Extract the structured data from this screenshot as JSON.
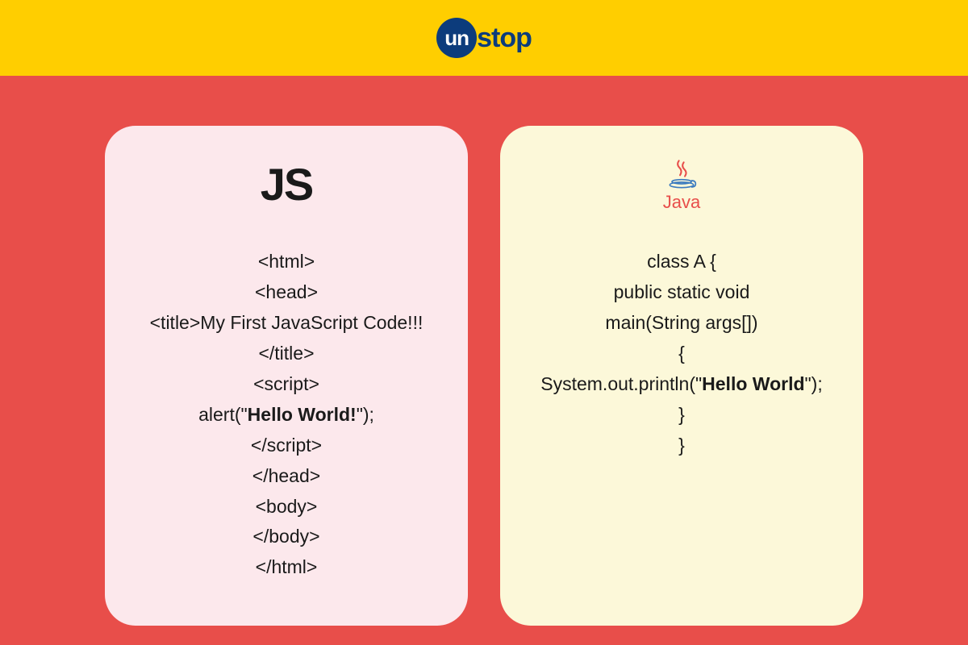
{
  "header": {
    "logo_un": "un",
    "logo_stop": "stop"
  },
  "cards": {
    "js": {
      "label": "JS",
      "code": {
        "l1": "<html>",
        "l2": "<head>",
        "l3": "<title>My First JavaScript Code!!!</title>",
        "l4": "<script>",
        "l5_pre": "alert(\"",
        "l5_bold": "Hello World!",
        "l5_post": "\");",
        "l6": "</script>",
        "l7": "</head>",
        "l8": "<body>",
        "l9": "</body>",
        "l10": "</html>"
      }
    },
    "java": {
      "label": "Java",
      "code": {
        "l1": "class A {",
        "l2": "public static void",
        "l3": "main(String args[])",
        "l4": "{",
        "l5_pre": "System.out.println(\"",
        "l5_bold": "Hello World",
        "l5_post": "\");",
        "l6": "}",
        "l7": "}"
      }
    }
  }
}
